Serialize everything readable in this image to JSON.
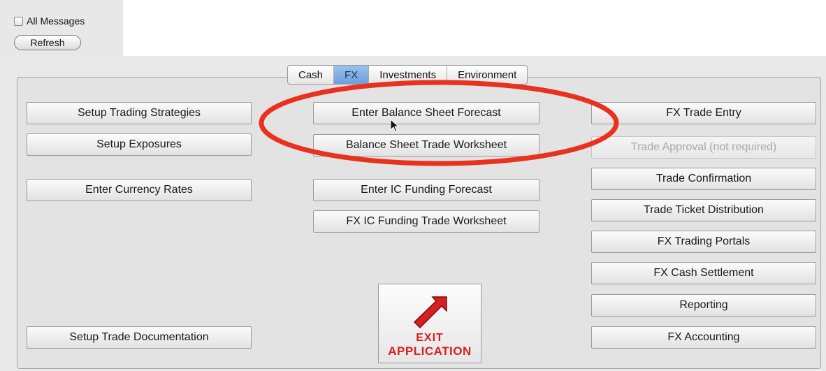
{
  "messages": {
    "checkbox_label": "All Messages",
    "refresh_label": "Refresh"
  },
  "tabs": [
    {
      "label": "Cash",
      "active": false
    },
    {
      "label": "FX",
      "active": true
    },
    {
      "label": "Investments",
      "active": false
    },
    {
      "label": "Environment",
      "active": false
    }
  ],
  "left_column": {
    "setup_trading_strategies": "Setup Trading Strategies",
    "setup_exposures": "Setup Exposures",
    "enter_currency_rates": "Enter Currency Rates",
    "setup_trade_documentation": "Setup Trade Documentation"
  },
  "middle_column": {
    "enter_balance_sheet_forecast": "Enter Balance Sheet Forecast",
    "balance_sheet_trade_worksheet": "Balance Sheet Trade Worksheet",
    "enter_ic_funding_forecast": "Enter IC Funding Forecast",
    "fx_ic_funding_trade_worksheet": "FX IC Funding Trade Worksheet"
  },
  "right_column": {
    "fx_trade_entry": "FX Trade Entry",
    "trade_approval": "Trade Approval (not required)",
    "trade_confirmation": "Trade Confirmation",
    "trade_ticket_distribution": "Trade Ticket Distribution",
    "fx_trading_portals": "FX Trading Portals",
    "fx_cash_settlement": "FX Cash Settlement",
    "reporting": "Reporting",
    "fx_accounting": "FX Accounting"
  },
  "exit": {
    "line1": "EXIT",
    "line2": "APPLICATION",
    "icon": "red-arrow-up-right-icon",
    "color": "#d81f1f"
  },
  "annotation": {
    "color": "#e8311f"
  }
}
